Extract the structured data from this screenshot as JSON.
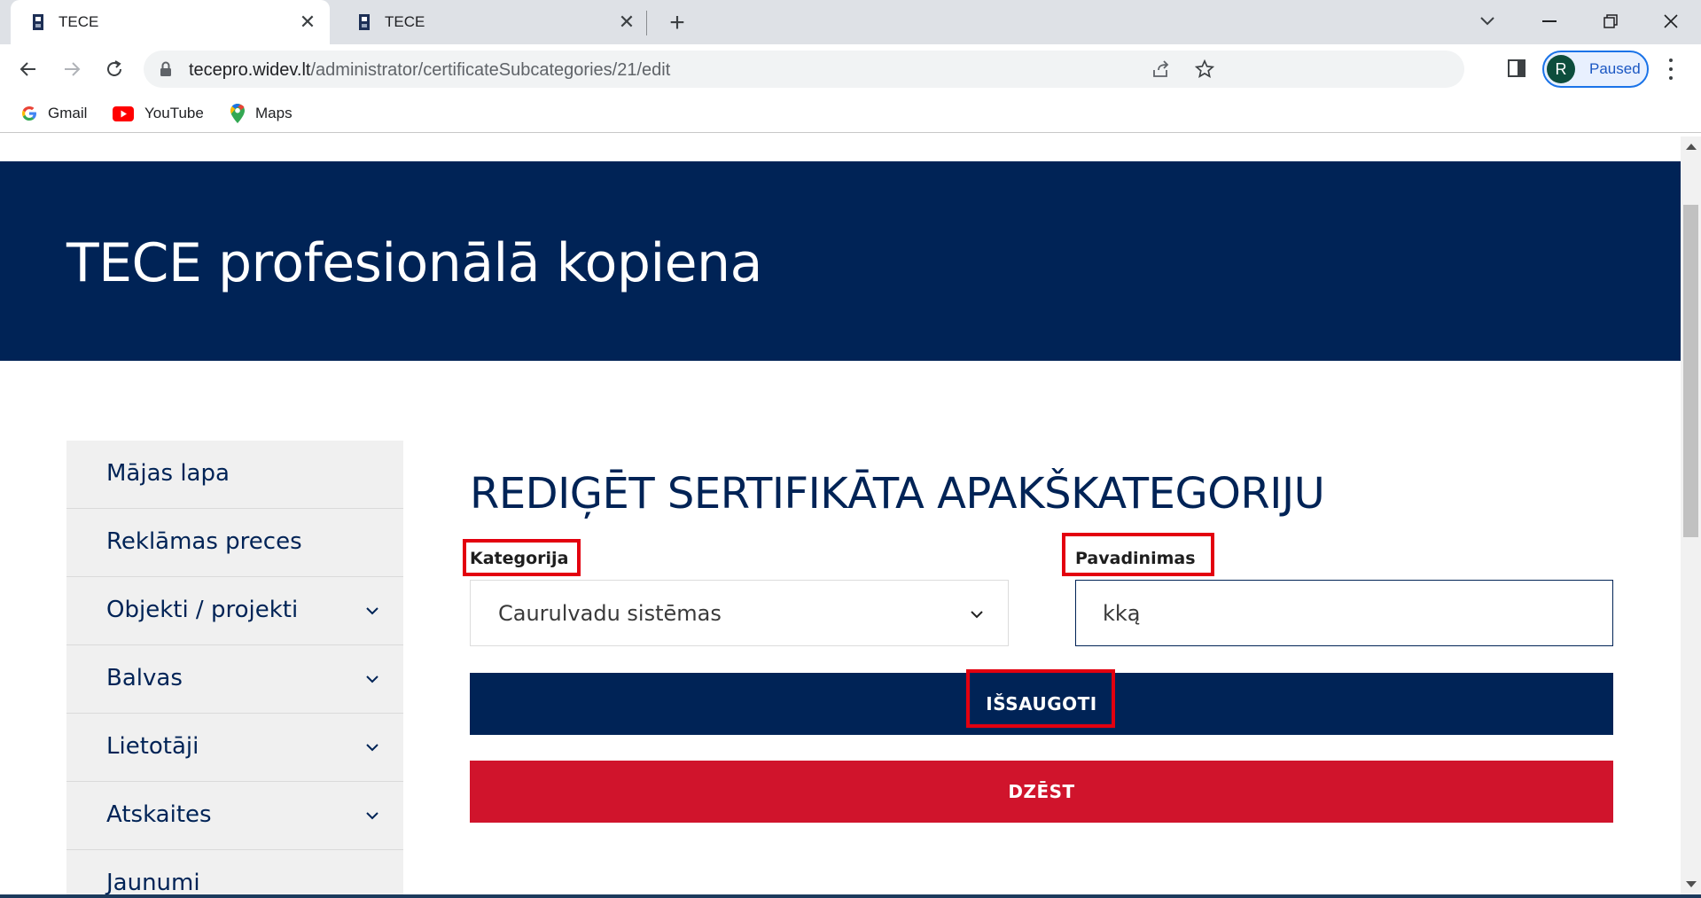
{
  "browser": {
    "tabs": [
      {
        "title": "TECE"
      },
      {
        "title": "TECE"
      }
    ],
    "url_host": "tecepro.widev.lt",
    "url_path": "/administrator/certificateSubcategories/21/edit",
    "profile_initial": "R",
    "profile_status": "Paused",
    "bookmarks": [
      {
        "label": "Gmail",
        "icon": "google-icon"
      },
      {
        "label": "YouTube",
        "icon": "youtube-icon"
      },
      {
        "label": "Maps",
        "icon": "maps-icon"
      }
    ]
  },
  "page": {
    "hero_title": "TECE profesionālā kopiena",
    "sidebar": [
      {
        "label": "Mājas lapa",
        "expandable": false
      },
      {
        "label": "Reklāmas preces",
        "expandable": false
      },
      {
        "label": "Objekti / projekti",
        "expandable": true
      },
      {
        "label": "Balvas",
        "expandable": true
      },
      {
        "label": "Lietotāji",
        "expandable": true
      },
      {
        "label": "Atskaites",
        "expandable": true
      },
      {
        "label": "Jaunumi",
        "expandable": false
      }
    ],
    "form": {
      "title": "REDIĢĒT SERTIFIKĀTA APAKŠKATEGORIJU",
      "category_label": "Kategorija",
      "category_value": "Caurulvadu sistēmas",
      "name_label": "Pavadinimas",
      "name_value": "kką",
      "save_label": "IŠSAUGOTI",
      "delete_label": "DZĒST"
    }
  },
  "colors": {
    "brand_navy": "#002356",
    "delete_red": "#d0142c",
    "highlight_red": "#e3000f"
  }
}
